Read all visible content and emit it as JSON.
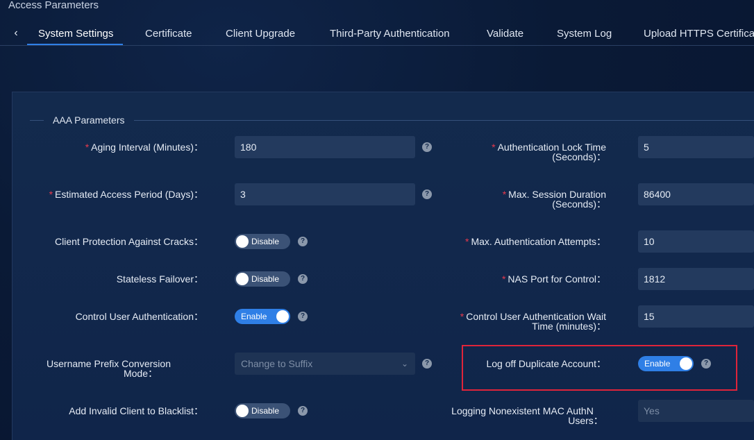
{
  "page": {
    "title": "Access Parameters"
  },
  "tabs": [
    {
      "label": "System Settings",
      "active": true
    },
    {
      "label": "Certificate"
    },
    {
      "label": "Client Upgrade"
    },
    {
      "label": "Third-Party Authentication"
    },
    {
      "label": "Validate"
    },
    {
      "label": "System Log"
    },
    {
      "label": "Upload HTTPS Certificat"
    }
  ],
  "section": {
    "title": "AAA Parameters"
  },
  "left": {
    "aging_interval": {
      "label": "Aging Interval (Minutes)：",
      "value": "180"
    },
    "estimated_access_period": {
      "label": "Estimated Access Period (Days)：",
      "value": "3"
    },
    "client_protection": {
      "label": "Client Protection Against Cracks：",
      "toggle": "Disable"
    },
    "stateless_failover": {
      "label": "Stateless Failover：",
      "toggle": "Disable"
    },
    "control_user_auth": {
      "label": "Control User Authentication：",
      "toggle": "Enable"
    },
    "username_prefix": {
      "label_line1": "Username Prefix Conversion",
      "label_line2": "Mode：",
      "value": "Change to Suffix"
    },
    "invalid_client_blacklist": {
      "label": "Add Invalid Client to Blacklist：",
      "toggle": "Disable"
    }
  },
  "right": {
    "auth_lock_time": {
      "label_line1": "Authentication Lock Time",
      "label_line2": "(Seconds)：",
      "value": "5"
    },
    "max_session_duration": {
      "label_line1": "Max. Session Duration",
      "label_line2": "(Seconds)：",
      "value": "86400"
    },
    "max_auth_attempts": {
      "label": "Max. Authentication Attempts：",
      "value": "10"
    },
    "nas_port": {
      "label": "NAS Port for Control：",
      "value": "1812"
    },
    "control_user_wait": {
      "label_line1": "Control User Authentication Wait",
      "label_line2": "Time (minutes)：",
      "value": "15"
    },
    "log_off_duplicate": {
      "label": "Log off Duplicate Account：",
      "toggle": "Enable"
    },
    "logging_nonexistent_mac": {
      "label_line1": "Logging Nonexistent MAC AuthN",
      "label_line2": "Users：",
      "value": "Yes"
    }
  },
  "required_mark": "*",
  "help_glyph": "?",
  "colors": {
    "accent": "#2f7fe6",
    "required": "#e8394d",
    "highlight": "#e0243a"
  }
}
